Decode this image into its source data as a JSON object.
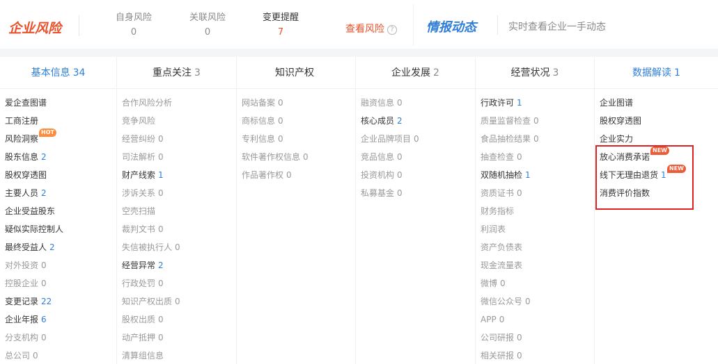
{
  "risk": {
    "logo": "企业风险",
    "stats": [
      {
        "label": "自身风险",
        "value": "0"
      },
      {
        "label": "关联风险",
        "value": "0"
      },
      {
        "label": "变更提醒",
        "value": "7"
      }
    ],
    "link": "查看风险",
    "help_glyph": "?"
  },
  "intel": {
    "logo": "情报动态",
    "desc": "实时查看企业一手动态"
  },
  "tabs": [
    {
      "label": "基本信息",
      "count": "34"
    },
    {
      "label": "重点关注",
      "count": "3"
    },
    {
      "label": "知识产权",
      "count": ""
    },
    {
      "label": "企业发展",
      "count": "2"
    },
    {
      "label": "经营状况",
      "count": "3"
    },
    {
      "label": "数据解读",
      "count": "1"
    }
  ],
  "columns": [
    [
      {
        "label": "爱企查图谱",
        "count": ""
      },
      {
        "label": "工商注册",
        "count": ""
      },
      {
        "label": "风险洞察",
        "count": "",
        "badge": "HOT"
      },
      {
        "label": "股东信息",
        "count": "2"
      },
      {
        "label": "股权穿透图",
        "count": ""
      },
      {
        "label": "主要人员",
        "count": "2"
      },
      {
        "label": "企业受益股东",
        "count": ""
      },
      {
        "label": "疑似实际控制人",
        "count": ""
      },
      {
        "label": "最终受益人",
        "count": "2"
      },
      {
        "label": "对外投资",
        "count": "0"
      },
      {
        "label": "控股企业",
        "count": "0"
      },
      {
        "label": "变更记录",
        "count": "22"
      },
      {
        "label": "企业年报",
        "count": "6"
      },
      {
        "label": "分支机构",
        "count": "0"
      },
      {
        "label": "总公司",
        "count": "0"
      }
    ],
    [
      {
        "label": "合作风险分析",
        "count": ""
      },
      {
        "label": "竞争风险",
        "count": ""
      },
      {
        "label": "经营纠纷",
        "count": "0"
      },
      {
        "label": "司法解析",
        "count": "0"
      },
      {
        "label": "财产线索",
        "count": "1"
      },
      {
        "label": "涉诉关系",
        "count": "0"
      },
      {
        "label": "空壳扫描",
        "count": ""
      },
      {
        "label": "裁判文书",
        "count": "0"
      },
      {
        "label": "失信被执行人",
        "count": "0"
      },
      {
        "label": "经营异常",
        "count": "2"
      },
      {
        "label": "行政处罚",
        "count": "0"
      },
      {
        "label": "知识产权出质",
        "count": "0"
      },
      {
        "label": "股权出质",
        "count": "0"
      },
      {
        "label": "动产抵押",
        "count": "0"
      },
      {
        "label": "清算组信息",
        "count": ""
      }
    ],
    [
      {
        "label": "网站备案",
        "count": "0"
      },
      {
        "label": "商标信息",
        "count": "0"
      },
      {
        "label": "专利信息",
        "count": "0"
      },
      {
        "label": "软件著作权信息",
        "count": "0"
      },
      {
        "label": "作品著作权",
        "count": "0"
      }
    ],
    [
      {
        "label": "融资信息",
        "count": "0"
      },
      {
        "label": "核心成员",
        "count": "2"
      },
      {
        "label": "企业品牌项目",
        "count": "0"
      },
      {
        "label": "竞品信息",
        "count": "0"
      },
      {
        "label": "投资机构",
        "count": "0"
      },
      {
        "label": "私募基金",
        "count": "0"
      }
    ],
    [
      {
        "label": "行政许可",
        "count": "1"
      },
      {
        "label": "质量监督检查",
        "count": "0"
      },
      {
        "label": "食品抽检结果",
        "count": "0"
      },
      {
        "label": "抽查检查",
        "count": "0"
      },
      {
        "label": "双随机抽检",
        "count": "1"
      },
      {
        "label": "资质证书",
        "count": "0"
      },
      {
        "label": "财务指标",
        "count": ""
      },
      {
        "label": "利润表",
        "count": ""
      },
      {
        "label": "资产负债表",
        "count": ""
      },
      {
        "label": "现金流量表",
        "count": ""
      },
      {
        "label": "微博",
        "count": "0"
      },
      {
        "label": "微信公众号",
        "count": "0"
      },
      {
        "label": "APP",
        "count": "0"
      },
      {
        "label": "公司研报",
        "count": "0"
      },
      {
        "label": "相关研报",
        "count": "0"
      }
    ],
    [
      {
        "label": "企业图谱",
        "count": ""
      },
      {
        "label": "股权穿透图",
        "count": ""
      },
      {
        "label": "企业实力",
        "count": ""
      },
      {
        "label": "放心消费承诺",
        "count": "",
        "badge": "NEW"
      },
      {
        "label": "线下无理由退货",
        "count": "1",
        "badge": "NEW"
      },
      {
        "label": "消费评价指数",
        "count": ""
      }
    ]
  ],
  "colors": {
    "accent": "#2f7ed8",
    "risk": "#e8512a",
    "highlight": "#e02020"
  }
}
